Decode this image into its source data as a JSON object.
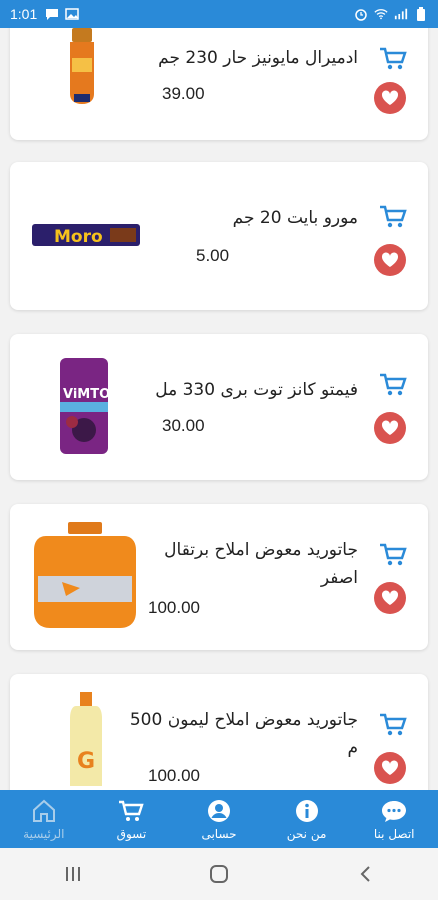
{
  "status_bar": {
    "time": "1:01"
  },
  "products": [
    {
      "name": "ادميرال مايونيز حار 230 جم",
      "price": "39.00"
    },
    {
      "name": "مورو بايت 20 جم",
      "price": "5.00"
    },
    {
      "name": "فيمتو كانز توت برى 330 مل",
      "price": "30.00"
    },
    {
      "name": "جاتوريد معوض املاح برتقال اصفر",
      "price": "100.00"
    },
    {
      "name": "جاتوريد معوض املاح ليمون 500 م",
      "price": "100.00"
    }
  ],
  "bottom_nav": [
    {
      "label": "اتصل بنا",
      "icon": "chat-icon"
    },
    {
      "label": "من نحن",
      "icon": "info-icon"
    },
    {
      "label": "حسابى",
      "icon": "account-icon"
    },
    {
      "label": "تسوق",
      "icon": "cart-icon"
    },
    {
      "label": "الرئيسية",
      "icon": "home-icon"
    }
  ],
  "colors": {
    "primary": "#2a8ad8",
    "favorite": "#d9534f",
    "cart_icon": "#2a8ad8"
  }
}
